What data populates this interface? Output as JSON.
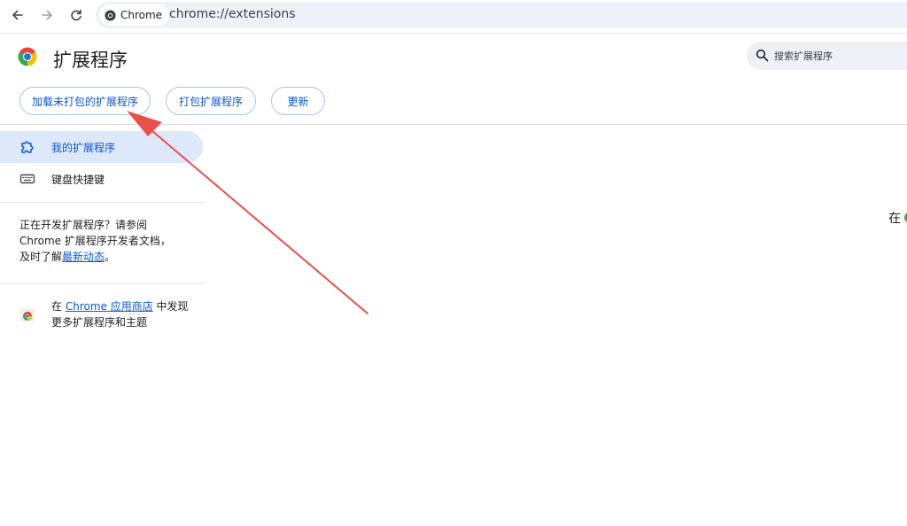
{
  "browser": {
    "nav": {
      "back_icon": "arrow-left-icon",
      "forward_icon": "arrow-right-icon",
      "reload_icon": "reload-icon"
    },
    "chip_label": "Chrome",
    "url": "chrome://extensions"
  },
  "header": {
    "title": "扩展程序",
    "search_placeholder": "搜索扩展程序"
  },
  "actions": {
    "load_unpacked": "加载未打包的扩展程序",
    "pack": "打包扩展程序",
    "update": "更新"
  },
  "sidebar": {
    "items": [
      {
        "label": "我的扩展程序",
        "icon": "puzzle-icon",
        "active": true
      },
      {
        "label": "键盘快捷键",
        "icon": "keyboard-icon",
        "active": false
      }
    ],
    "dev_note": {
      "line1": "正在开发扩展程序？请参阅",
      "line2": "Chrome 扩展程序开发者文档，",
      "line3_prefix": "及时了解",
      "link": "最新动态",
      "line3_suffix": "。"
    },
    "store_note": {
      "prefix": "在 ",
      "link": "Chrome 应用商店",
      "suffix": " 中发现更多扩展程序和主题"
    }
  },
  "main": {
    "edge_text": "在"
  },
  "colors": {
    "accent": "#0b57d0",
    "active_bg": "#dde8fb",
    "annotation_arrow": "#e8504b"
  }
}
